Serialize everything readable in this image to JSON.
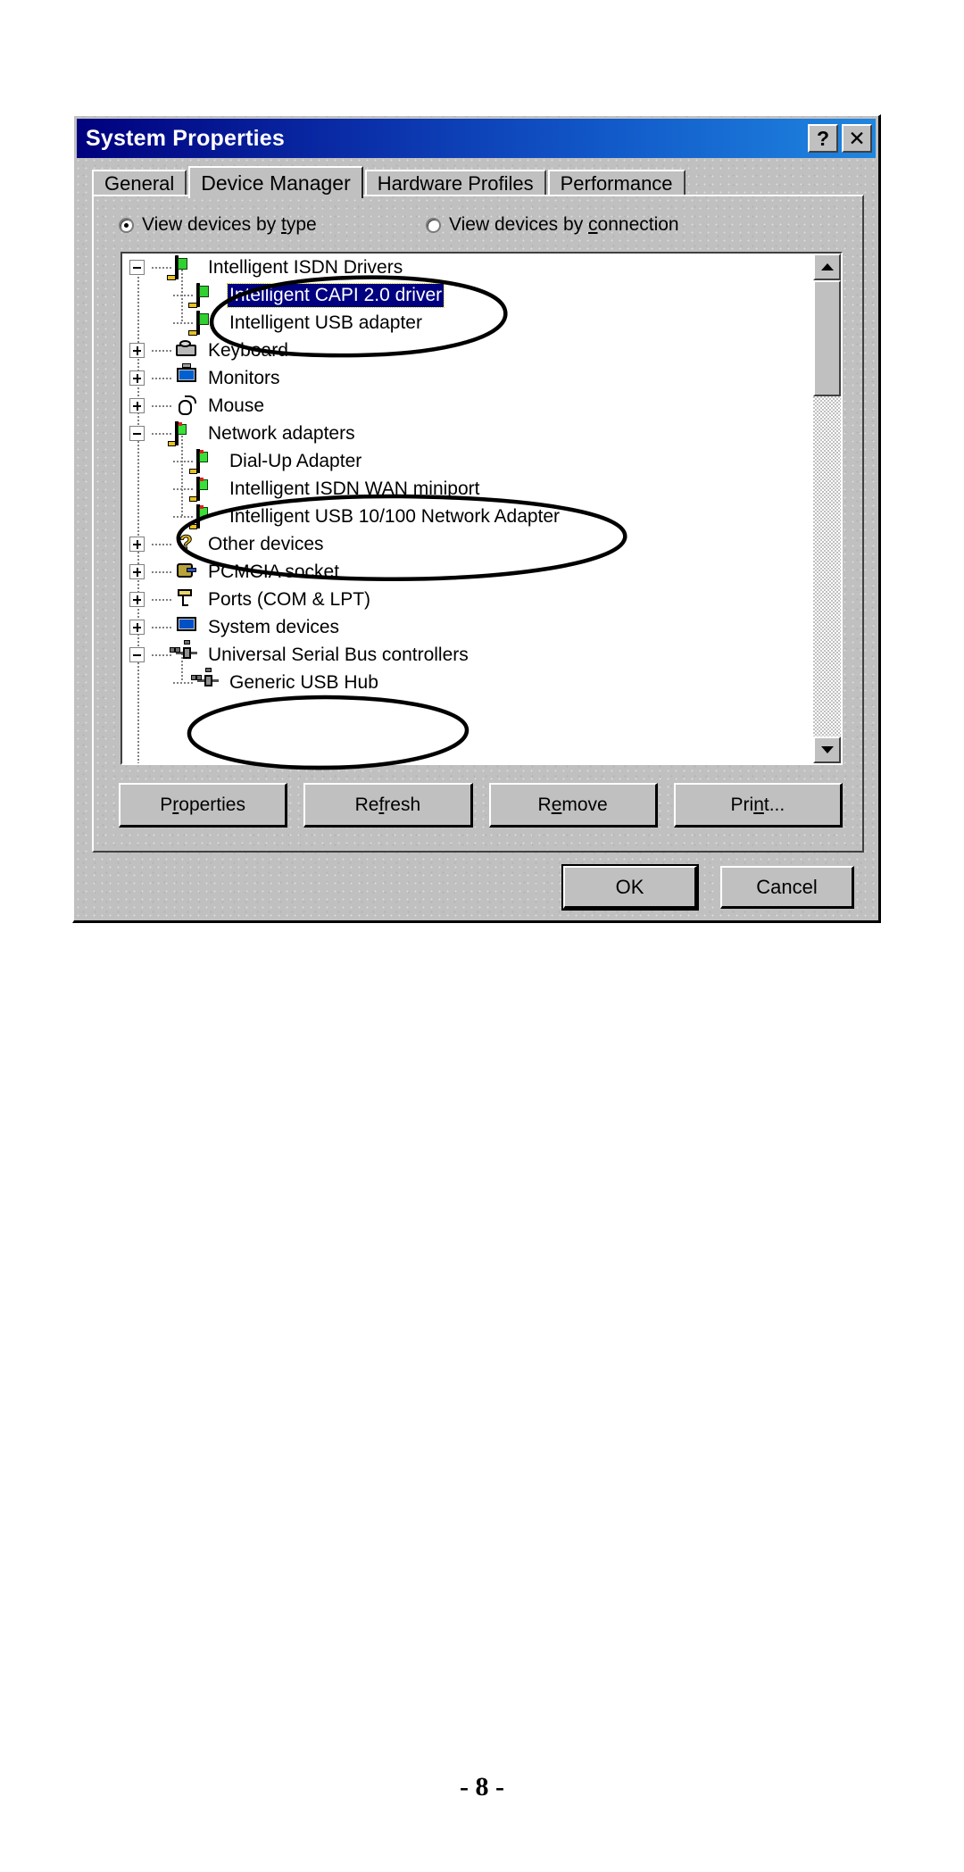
{
  "page": {
    "number": "- 8 -"
  },
  "window": {
    "title": "System Properties",
    "help_button": "?",
    "close_button": "✕"
  },
  "tabs": [
    {
      "label": "General",
      "active": false
    },
    {
      "label": "Device Manager",
      "active": true
    },
    {
      "label": "Hardware Profiles",
      "active": false
    },
    {
      "label": "Performance",
      "active": false
    }
  ],
  "view_options": {
    "by_type": {
      "label": "View devices by type",
      "checked": true,
      "accel": "t"
    },
    "by_connection": {
      "label": "View devices by connection",
      "checked": false,
      "accel": "c"
    }
  },
  "tree": {
    "nodes": [
      {
        "label": "Intelligent ISDN Drivers",
        "level": 0,
        "expander": "minus",
        "icon": "isdn-card-icon",
        "selected": false
      },
      {
        "label": "Intelligent CAPI 2.0 driver",
        "level": 1,
        "expander": "none",
        "icon": "isdn-card-icon",
        "selected": true
      },
      {
        "label": "Intelligent USB adapter",
        "level": 1,
        "expander": "none",
        "icon": "isdn-card-icon",
        "selected": false
      },
      {
        "label": "Keyboard",
        "level": 0,
        "expander": "plus",
        "icon": "keyboard-icon",
        "selected": false
      },
      {
        "label": "Monitors",
        "level": 0,
        "expander": "plus",
        "icon": "monitor-icon",
        "selected": false
      },
      {
        "label": "Mouse",
        "level": 0,
        "expander": "plus",
        "icon": "mouse-icon",
        "selected": false
      },
      {
        "label": "Network adapters",
        "level": 0,
        "expander": "minus",
        "icon": "network-card-icon",
        "selected": false
      },
      {
        "label": "Dial-Up Adapter",
        "level": 1,
        "expander": "none",
        "icon": "network-card-icon",
        "selected": false
      },
      {
        "label": "Intelligent ISDN WAN miniport",
        "level": 1,
        "expander": "none",
        "icon": "network-card-icon",
        "selected": false
      },
      {
        "label": "Intelligent USB 10/100 Network Adapter",
        "level": 1,
        "expander": "none",
        "icon": "network-card-icon",
        "selected": false
      },
      {
        "label": "Other devices",
        "level": 0,
        "expander": "plus",
        "icon": "question-mark-icon",
        "selected": false
      },
      {
        "label": "PCMCIA socket",
        "level": 0,
        "expander": "plus",
        "icon": "pcmcia-icon",
        "selected": false
      },
      {
        "label": "Ports (COM & LPT)",
        "level": 0,
        "expander": "plus",
        "icon": "port-icon",
        "selected": false
      },
      {
        "label": "System devices",
        "level": 0,
        "expander": "plus",
        "icon": "system-icon",
        "selected": false
      },
      {
        "label": "Universal Serial Bus controllers",
        "level": 0,
        "expander": "minus",
        "icon": "usb-icon",
        "selected": false
      },
      {
        "label": "Generic USB Hub",
        "level": 1,
        "expander": "none",
        "icon": "usb-icon",
        "selected": false
      }
    ]
  },
  "scrollbar": {
    "up_arrow": "scroll-up",
    "down_arrow": "scroll-down",
    "thumb": "scroll-thumb"
  },
  "actions": [
    {
      "label": "Properties",
      "accel": "r"
    },
    {
      "label": "Refresh",
      "accel": "f"
    },
    {
      "label": "Remove",
      "accel": "e"
    },
    {
      "label": "Print...",
      "accel": "n"
    }
  ],
  "footer": {
    "ok": "OK",
    "cancel": "Cancel"
  },
  "annotations": [
    {
      "name": "ellipse-isdn-drivers",
      "target": "Intelligent CAPI 2.0 driver / Intelligent USB adapter"
    },
    {
      "name": "ellipse-network-adapters",
      "target": "Intelligent ISDN WAN miniport / Intelligent USB 10/100 Network Adapter"
    },
    {
      "name": "ellipse-usb-hub",
      "target": "Generic USB Hub"
    }
  ],
  "colors": {
    "titlebar_start": "#00007e",
    "titlebar_end": "#1f86e0",
    "dialog_face": "#c0c0c0",
    "selection": "#000080",
    "list_background": "#ffffff",
    "annotation_ink": "#000000"
  }
}
